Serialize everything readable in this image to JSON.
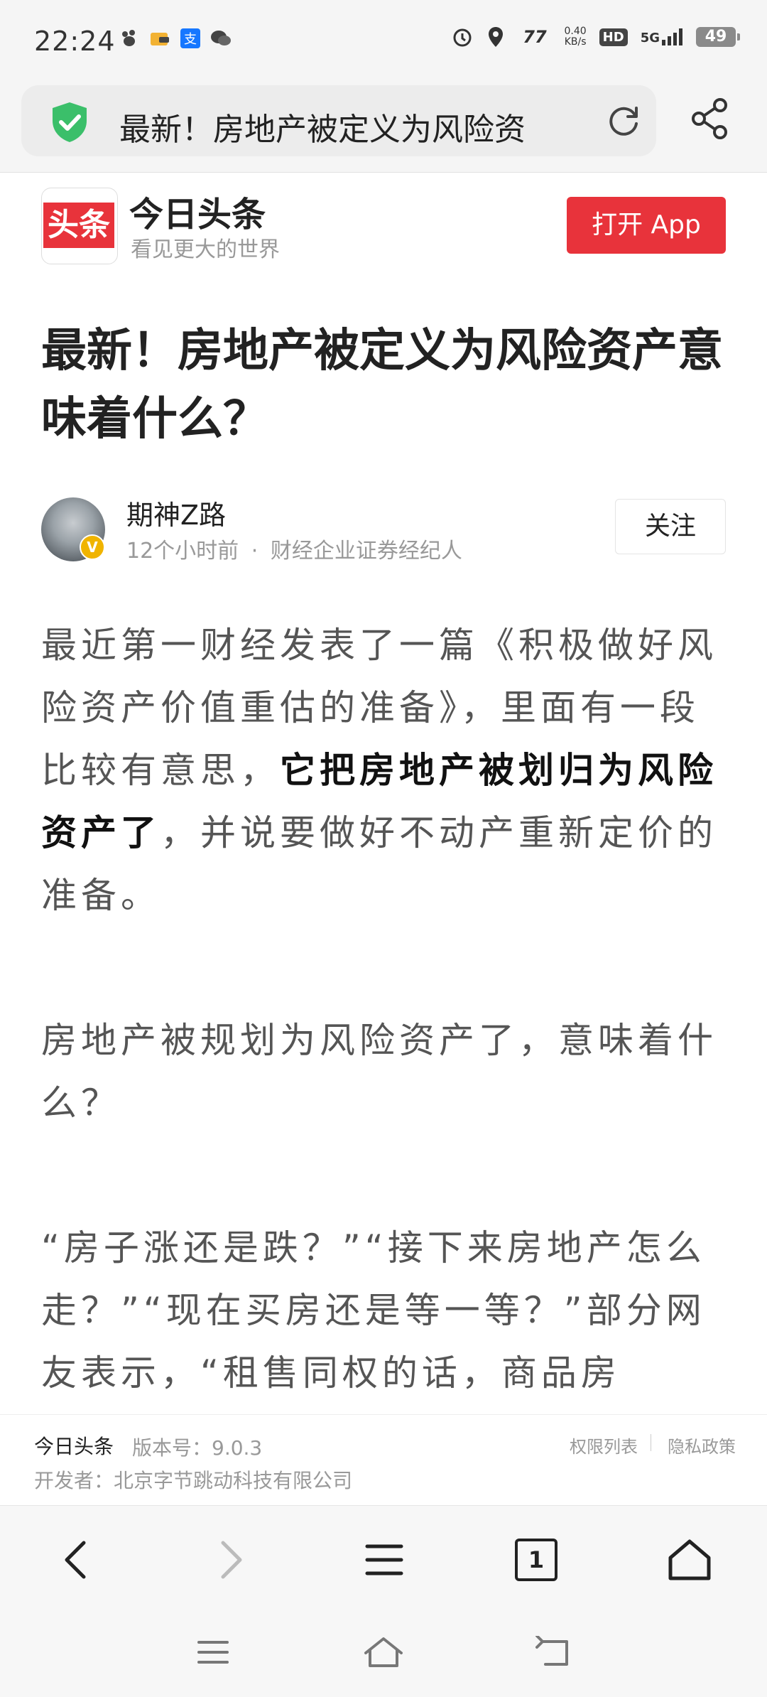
{
  "status_bar": {
    "time": "22:24",
    "net_speed_value": "0.40",
    "net_speed_unit": "KB/s",
    "hd_badge": "HD",
    "network": "5G",
    "battery": "49",
    "icons": [
      "paw-icon",
      "wallet-icon",
      "alipay-icon",
      "wechat-icon",
      "alarm-icon",
      "location-icon",
      "signal-77-icon",
      "cell-signal-icon"
    ]
  },
  "address_bar": {
    "url_title": "最新！房地产被定义为风险资",
    "icons": [
      "security-shield-icon",
      "reload-icon",
      "share-icon"
    ]
  },
  "app_promo": {
    "logo_text": "头条",
    "app_name": "今日头条",
    "slogan": "看见更大的世界",
    "open_button": "打开 App"
  },
  "article": {
    "title": "最新！房地产被定义为风险资产意味着什么？",
    "author": {
      "name": "期神Z路",
      "time": "12个小时前",
      "separator": "·",
      "role": "财经企业证券经纪人",
      "badge": "V",
      "follow_button": "关注"
    },
    "paragraphs": [
      {
        "before": "最近第一财经发表了一篇《积极做好风险资产价值重估的准备》，里面有一段比较有意思，",
        "bold": "它把房地产被划归为风险资产了",
        "after": "，并说要做好不动产重新定价的准备。"
      },
      {
        "text": "房地产被规划为风险资产了，意味着什么？"
      },
      {
        "text": "“房子涨还是跌？”“接下来房地产怎么走？”“现在买房还是等一等？”部分网友表示，“租售同权的话，商品房"
      }
    ]
  },
  "app_info": {
    "app_name": "今日头条",
    "version": "版本号：9.0.3",
    "permissions_link": "权限列表",
    "privacy_link": "隐私政策",
    "developer": "开发者：北京字节跳动科技有限公司"
  },
  "toolbar": {
    "tab_count": "1",
    "buttons": [
      "back-icon",
      "forward-icon",
      "menu-icon",
      "tabs-icon",
      "home-icon"
    ]
  },
  "system_nav": {
    "buttons": [
      "recents-icon",
      "home-icon",
      "back-icon"
    ]
  },
  "colors": {
    "brand_red": "#e8333b",
    "shield_green": "#3bbf6a",
    "badge_gold": "#f0b400"
  }
}
